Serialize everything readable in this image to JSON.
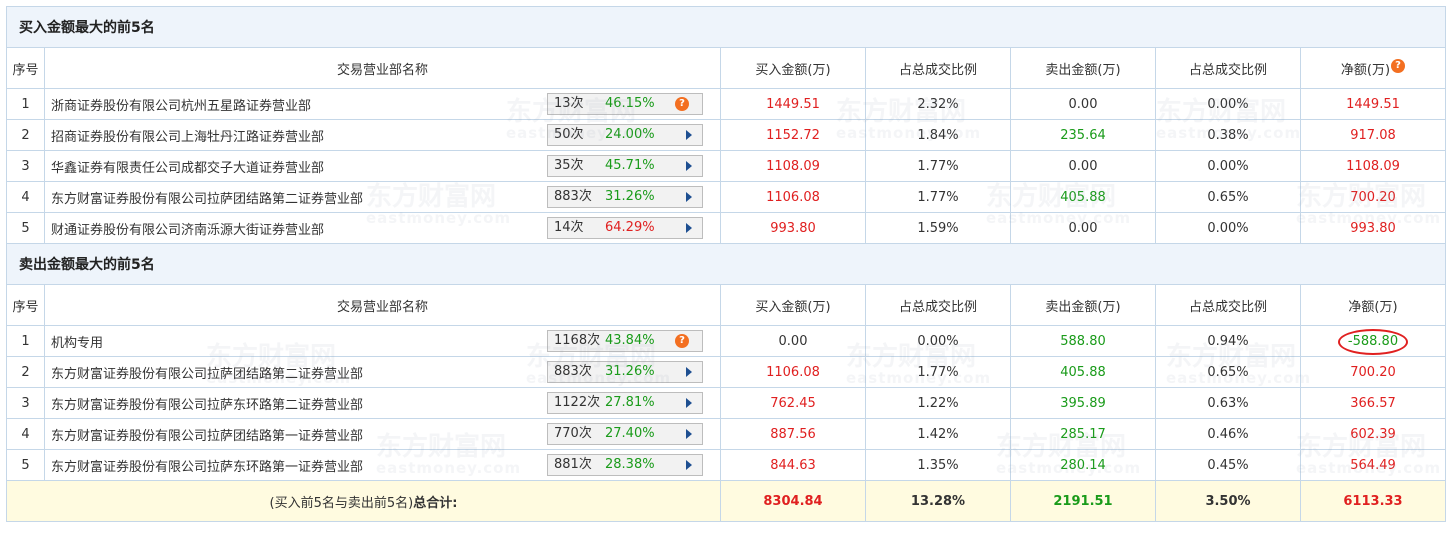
{
  "watermark": {
    "cn": "东方财富网",
    "en": "eastmoney.com"
  },
  "headers": {
    "index": "序号",
    "dept": "交易营业部名称",
    "buy_amount": "买入金额(万)",
    "buy_ratio": "占总成交比例",
    "sell_amount": "卖出金额(万)",
    "sell_ratio": "占总成交比例",
    "net": "净额(万)"
  },
  "buy_section": {
    "title": "买入金额最大的前5名",
    "rows": [
      {
        "idx": "1",
        "name": "浙商证券股份有限公司杭州五星路证券营业部",
        "count": "13次",
        "pct": "46.15%",
        "pct_color": "green",
        "icon": "question",
        "buy": "1449.51",
        "buy_ratio": "2.32%",
        "sell": "0.00",
        "sell_ratio": "0.00%",
        "net": "1449.51",
        "net_color": "red"
      },
      {
        "idx": "2",
        "name": "招商证券股份有限公司上海牡丹江路证券营业部",
        "count": "50次",
        "pct": "24.00%",
        "pct_color": "green",
        "icon": "arrow",
        "buy": "1152.72",
        "buy_ratio": "1.84%",
        "sell": "235.64",
        "sell_ratio": "0.38%",
        "net": "917.08",
        "net_color": "red"
      },
      {
        "idx": "3",
        "name": "华鑫证券有限责任公司成都交子大道证券营业部",
        "count": "35次",
        "pct": "45.71%",
        "pct_color": "green",
        "icon": "arrow",
        "buy": "1108.09",
        "buy_ratio": "1.77%",
        "sell": "0.00",
        "sell_ratio": "0.00%",
        "net": "1108.09",
        "net_color": "red"
      },
      {
        "idx": "4",
        "name": "东方财富证券股份有限公司拉萨团结路第二证券营业部",
        "count": "883次",
        "pct": "31.26%",
        "pct_color": "green",
        "icon": "arrow",
        "buy": "1106.08",
        "buy_ratio": "1.77%",
        "sell": "405.88",
        "sell_ratio": "0.65%",
        "net": "700.20",
        "net_color": "red"
      },
      {
        "idx": "5",
        "name": "财通证券股份有限公司济南泺源大街证券营业部",
        "count": "14次",
        "pct": "64.29%",
        "pct_color": "red",
        "icon": "arrow",
        "buy": "993.80",
        "buy_ratio": "1.59%",
        "sell": "0.00",
        "sell_ratio": "0.00%",
        "net": "993.80",
        "net_color": "red"
      }
    ]
  },
  "sell_section": {
    "title": "卖出金额最大的前5名",
    "rows": [
      {
        "idx": "1",
        "name": "机构专用",
        "count": "1168次",
        "pct": "43.84%",
        "pct_color": "green",
        "icon": "question",
        "buy": "0.00",
        "buy_ratio": "0.00%",
        "sell": "588.80",
        "sell_ratio": "0.94%",
        "net": "-588.80",
        "net_color": "green",
        "circled": true
      },
      {
        "idx": "2",
        "name": "东方财富证券股份有限公司拉萨团结路第二证券营业部",
        "count": "883次",
        "pct": "31.26%",
        "pct_color": "green",
        "icon": "arrow",
        "buy": "1106.08",
        "buy_ratio": "1.77%",
        "sell": "405.88",
        "sell_ratio": "0.65%",
        "net": "700.20",
        "net_color": "red"
      },
      {
        "idx": "3",
        "name": "东方财富证券股份有限公司拉萨东环路第二证券营业部",
        "count": "1122次",
        "pct": "27.81%",
        "pct_color": "green",
        "icon": "arrow",
        "buy": "762.45",
        "buy_ratio": "1.22%",
        "sell": "395.89",
        "sell_ratio": "0.63%",
        "net": "366.57",
        "net_color": "red"
      },
      {
        "idx": "4",
        "name": "东方财富证券股份有限公司拉萨团结路第一证券营业部",
        "count": "770次",
        "pct": "27.40%",
        "pct_color": "green",
        "icon": "arrow",
        "buy": "887.56",
        "buy_ratio": "1.42%",
        "sell": "285.17",
        "sell_ratio": "0.46%",
        "net": "602.39",
        "net_color": "red"
      },
      {
        "idx": "5",
        "name": "东方财富证券股份有限公司拉萨东环路第一证券营业部",
        "count": "881次",
        "pct": "28.38%",
        "pct_color": "green",
        "icon": "arrow",
        "buy": "844.63",
        "buy_ratio": "1.35%",
        "sell": "280.14",
        "sell_ratio": "0.45%",
        "net": "564.49",
        "net_color": "red"
      }
    ]
  },
  "total": {
    "label": "(买入前5名与卖出前5名)",
    "label_bold": "总合计:",
    "buy": "8304.84",
    "buy_ratio": "13.28%",
    "sell": "2191.51",
    "sell_ratio": "3.50%",
    "net": "6113.33"
  },
  "colors": {
    "red": "#e02020",
    "green": "#1a9b1a",
    "title_bg": "#eef4fb",
    "total_bg": "#fffbe0",
    "border": "#c5d7e8",
    "icon_orange": "#f36f21",
    "arrow_blue": "#1e4f91"
  }
}
